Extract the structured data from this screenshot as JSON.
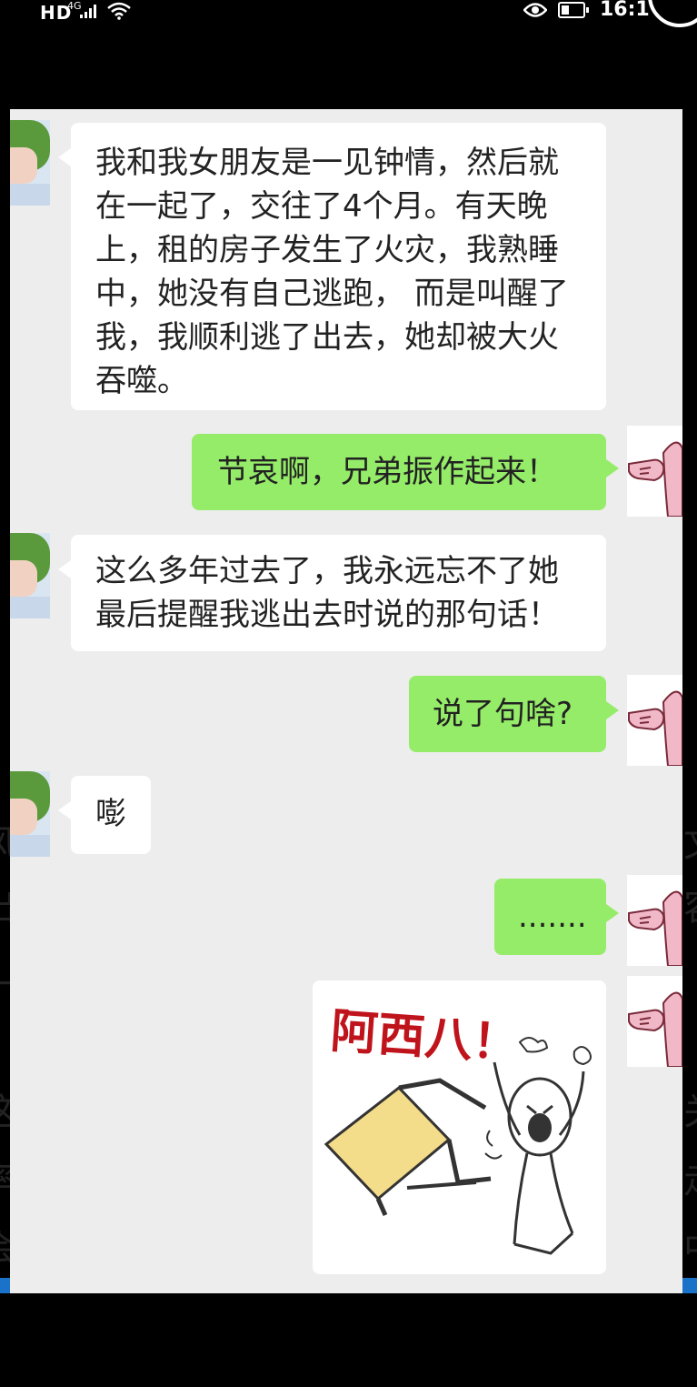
{
  "status_bar": {
    "hd": "HD",
    "network": "4G",
    "time": "16:1"
  },
  "messages": [
    {
      "sender": "friend",
      "text": "我和我女朋友是一见钟情，然后就在一起了，交往了4个月。有天晚上，租的房子发生了火灾，我熟睡中，她没有自己逃跑， 而是叫醒了我，我顺利逃了出去，她却被大火吞噬。"
    },
    {
      "sender": "me",
      "text": "节哀啊，兄弟振作起来！"
    },
    {
      "sender": "friend",
      "text": "这么多年过去了，我永远忘不了她最后提醒我逃出去时说的那句话！"
    },
    {
      "sender": "me",
      "text": "说了句啥?"
    },
    {
      "sender": "friend",
      "text": "嘭"
    },
    {
      "sender": "me",
      "text": "......."
    },
    {
      "sender": "me",
      "type": "sticker",
      "sticker_text": "阿西八！"
    }
  ],
  "background_edge_text": {
    "left": [
      "风",
      "出",
      "一",
      "这",
      "率",
      "会"
    ],
    "right": [
      "文",
      "容",
      "关",
      "走",
      "中"
    ]
  },
  "colors": {
    "chat_bg": "#ededed",
    "sent_bubble": "#95ec69",
    "received_bubble": "#ffffff",
    "sticker_text": "#c0141c"
  }
}
